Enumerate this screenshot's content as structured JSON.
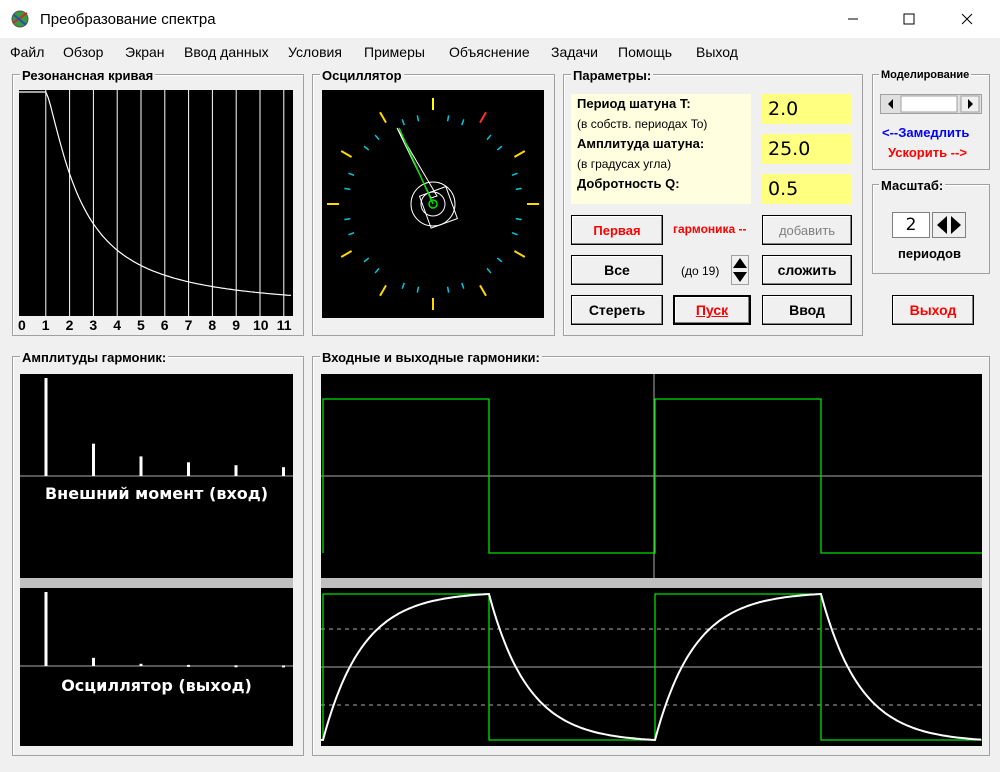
{
  "window": {
    "title": "Преобразование спектра"
  },
  "menu": [
    "Файл",
    "Обзор",
    "Экран",
    "Ввод данных",
    "Условия",
    "Примеры",
    "Объяснение",
    "Задачи",
    "Помощь",
    "Выход"
  ],
  "resonance": {
    "title": "Резонансная кривая",
    "ticks": [
      "0",
      "1",
      "2",
      "3",
      "4",
      "5",
      "6",
      "7",
      "8",
      "9",
      "10",
      "11"
    ]
  },
  "oscillator": {
    "title": "Осциллятор"
  },
  "params": {
    "title": "Параметры:",
    "period_label": "Период шатуна T:",
    "period_sub": "(в собств. периодах To)",
    "period_value": "2.0",
    "amp_label": "Амплитуда шатуна:",
    "amp_sub": "(в градусах угла)",
    "amp_value": "25.0",
    "q_label": "Добротность Q:",
    "q_value": "0.5",
    "first_btn": "Первая",
    "harmonic_label": "гармоника --",
    "add_btn": "добавить",
    "all_btn": "Все",
    "upto_label": "(до 19)",
    "sum_btn": "сложить",
    "erase_btn": "Стереть",
    "start_btn": "Пуск",
    "input_btn": "Ввод"
  },
  "modeling": {
    "title": "Моделирование",
    "slower": "<--Замедлить",
    "faster": "Ускорить -->"
  },
  "scale": {
    "title": "Масштаб:",
    "value": "2",
    "unit": "периодов"
  },
  "exit_btn": "Выход",
  "harmonics": {
    "title": "Амплитуды гармоник:",
    "input_label": "Внешний момент (вход)",
    "output_label": "Осциллятор (выход)",
    "input_bars": [
      1.0,
      0.33,
      0.2,
      0.14,
      0.11,
      0.09
    ],
    "output_bars": [
      1.0,
      0.11,
      0.03,
      0.015,
      0.01,
      0.008
    ]
  },
  "waves": {
    "title": "Входные и выходные гармоники:"
  },
  "colors": {
    "green": "#00e000",
    "white": "#ffffff",
    "yellow": "#ffff80",
    "red": "#ff0000",
    "blue": "#0000ff"
  }
}
